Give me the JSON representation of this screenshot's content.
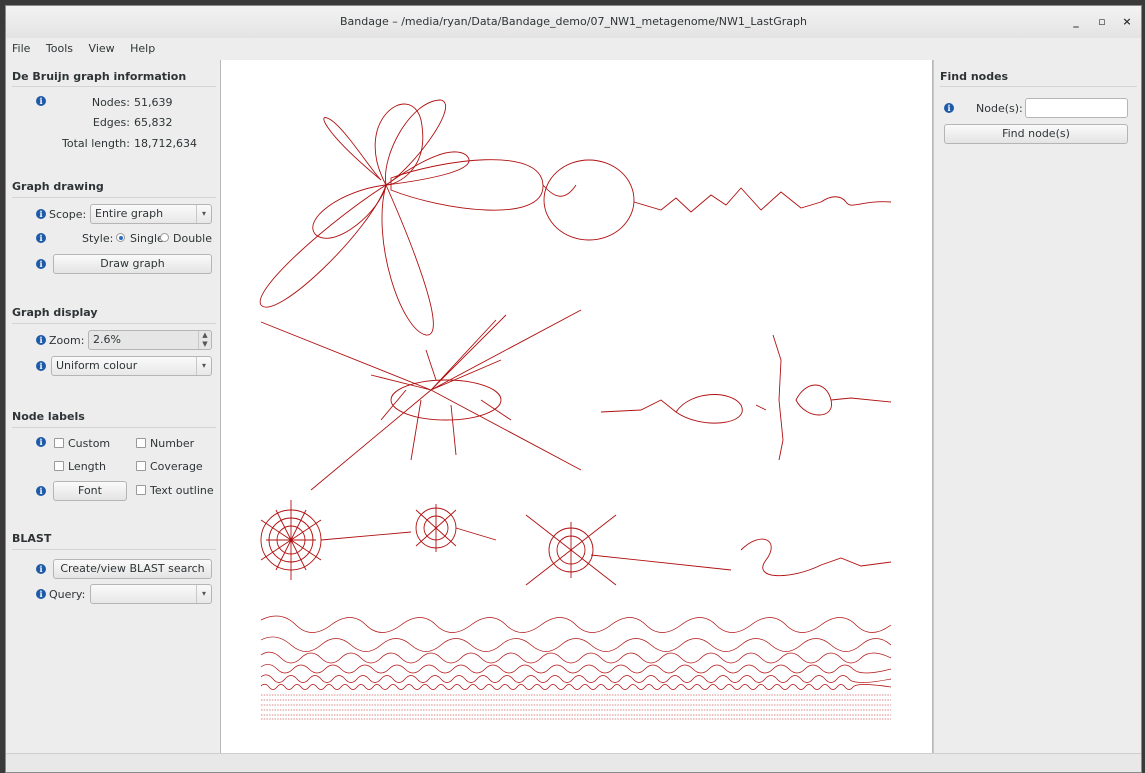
{
  "window": {
    "title": "Bandage – /media/ryan/Data/Bandage_demo/07_NW1_metagenome/NW1_LastGraph",
    "controls": {
      "minimize": "_",
      "maximize": "▫",
      "close": "×"
    }
  },
  "menu": [
    "File",
    "Tools",
    "View",
    "Help"
  ],
  "graph_info": {
    "title": "De Bruijn graph information",
    "nodes_label": "Nodes:",
    "nodes_value": "51,639",
    "edges_label": "Edges:",
    "edges_value": "65,832",
    "length_label": "Total length:",
    "length_value": "18,712,634"
  },
  "graph_drawing": {
    "title": "Graph drawing",
    "scope_label": "Scope:",
    "scope_value": "Entire graph",
    "style_label": "Style:",
    "style_single": "Single",
    "style_double": "Double",
    "style_selected": "Single",
    "draw_button": "Draw graph"
  },
  "graph_display": {
    "title": "Graph display",
    "zoom_label": "Zoom:",
    "zoom_value": "2.6%",
    "colour_value": "Uniform colour"
  },
  "node_labels": {
    "title": "Node labels",
    "custom": "Custom",
    "number": "Number",
    "length": "Length",
    "coverage": "Coverage",
    "font_button": "Font",
    "text_outline": "Text outline"
  },
  "blast": {
    "title": "BLAST",
    "search_button": "Create/view BLAST search",
    "query_label": "Query:",
    "query_value": ""
  },
  "find_nodes": {
    "title": "Find nodes",
    "nodes_label": "Node(s):",
    "nodes_value": "",
    "find_button": "Find node(s)"
  },
  "colors": {
    "graph_stroke": "#b01010",
    "info_icon": "#1e5aa8"
  }
}
